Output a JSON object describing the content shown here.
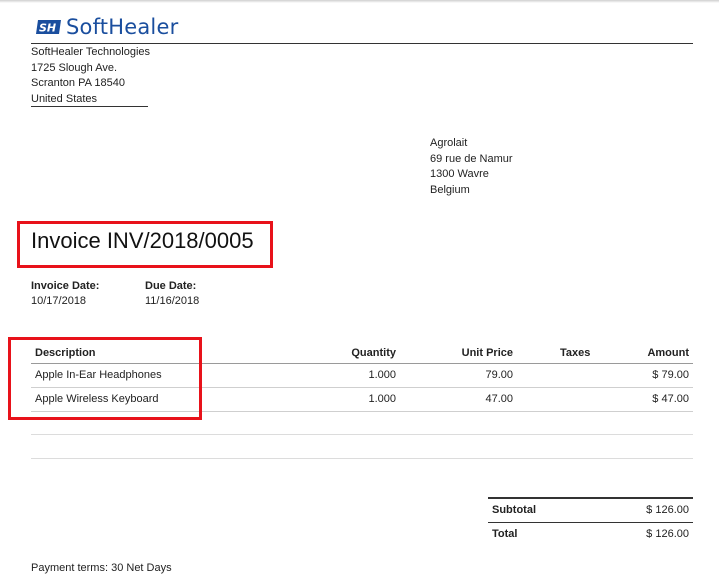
{
  "brand": {
    "name": "SoftHealer",
    "logo_icon": "sh-logo-icon",
    "color": "#1a4e9e"
  },
  "company": {
    "lines": [
      "SoftHealer Technologies",
      "1725 Slough Ave.",
      "Scranton PA 18540",
      "United States"
    ]
  },
  "customer": {
    "lines": [
      "Agrolait",
      "69 rue de Namur",
      "1300 Wavre",
      "Belgium"
    ]
  },
  "invoice": {
    "title": "Invoice INV/2018/0005",
    "invoice_date_label": "Invoice Date:",
    "invoice_date": "10/17/2018",
    "due_date_label": "Due Date:",
    "due_date": "11/16/2018"
  },
  "table": {
    "headers": {
      "description": "Description",
      "quantity": "Quantity",
      "unit_price": "Unit Price",
      "taxes": "Taxes",
      "amount": "Amount"
    },
    "rows": [
      {
        "description": "Apple In-Ear Headphones",
        "quantity": "1.000",
        "unit_price": "79.00",
        "taxes": "",
        "amount": "$ 79.00"
      },
      {
        "description": "Apple Wireless Keyboard",
        "quantity": "1.000",
        "unit_price": "47.00",
        "taxes": "",
        "amount": "$ 47.00"
      }
    ]
  },
  "totals": {
    "subtotal_label": "Subtotal",
    "subtotal": "$ 126.00",
    "total_label": "Total",
    "total": "$ 126.00"
  },
  "payment_terms": "Payment terms: 30 Net Days",
  "highlight_color": "#e8121a"
}
